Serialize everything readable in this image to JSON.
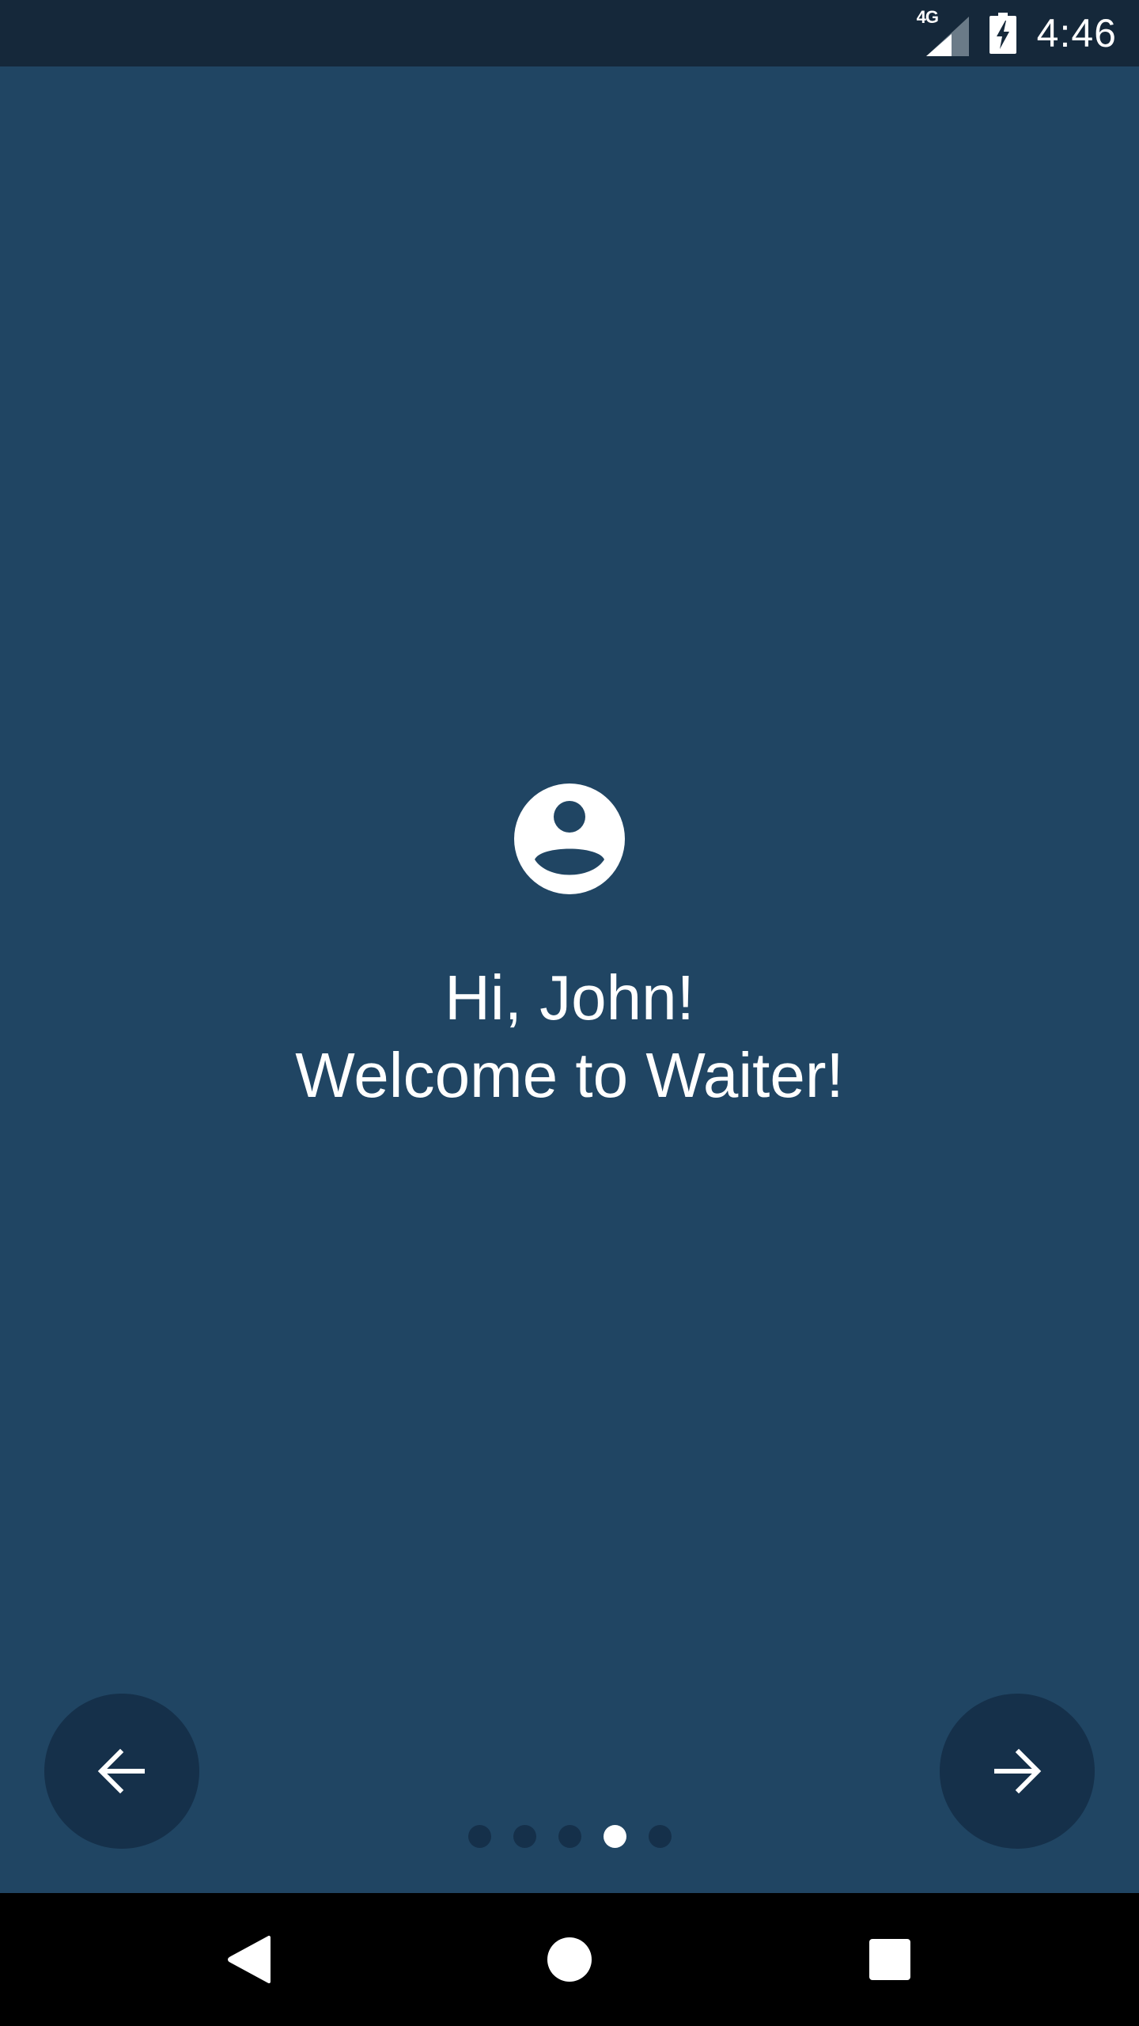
{
  "status_bar": {
    "network_label": "4G",
    "time": "4:46",
    "icons": [
      "signal-icon",
      "battery-charging-icon"
    ]
  },
  "welcome": {
    "icon": "account-circle-icon",
    "line1": "Hi, John!",
    "line2": "Welcome to Waiter!"
  },
  "navigation": {
    "prev_icon": "arrow-left-icon",
    "next_icon": "arrow-right-icon"
  },
  "pager": {
    "total": 5,
    "active_index": 3
  },
  "system_nav": {
    "icons": [
      "back-icon",
      "home-icon",
      "recents-icon"
    ]
  },
  "colors": {
    "background": "#204563",
    "status_bar": "#15283a",
    "button": "#15304a",
    "foreground": "#ffffff"
  }
}
